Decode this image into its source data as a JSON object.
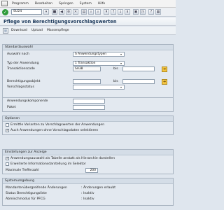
{
  "menu": {
    "items": [
      "Programm",
      "Bearbeiten",
      "Springen",
      "System",
      "Hilfe"
    ]
  },
  "toolbar": {
    "check_icon": "check-icon",
    "tcode_value": "SU24"
  },
  "window_title": "Pflege von Berechtigungsvorschlagswerten",
  "app_toolbar": {
    "buttons": [
      "Download",
      "Upload",
      "Massenpflege"
    ]
  },
  "standardauswahl": {
    "title": "Standardauswahl",
    "auswahl_nach_label": "Auswahl nach",
    "auswahl_nach_value": "S Anwendungstypen",
    "typ_label": "Typ der Anwendung",
    "typ_value": "1 Transaktion",
    "transaktionscode_label": "Transaktionscode",
    "transaktionscode_value": "SA38",
    "bis_label": "bis",
    "berechtigungsobjekt_label": "Berechtigungsobjekt",
    "berechtigungsobjekt_bis_label": "bis",
    "vorschlagsstatus_label": "Vorschlagsstatus",
    "anwendungskomponente_label": "Anwendungskomponente",
    "paket_label": "Paket"
  },
  "optionen": {
    "title": "Optionen",
    "items": [
      {
        "label": "Ermittle Varianten zu Vorschlagswerten der Anwendungen",
        "checked": false
      },
      {
        "label": "Auch Anwendungen ohne Vorschlagsdaten selektieren",
        "checked": true
      }
    ]
  },
  "einstellungen": {
    "title": "Einstellungen zur Anzeige",
    "items": [
      {
        "label": "Anwendungsauswahl als Tabelle anstatt als Hierarchie darstellen",
        "checked": true
      },
      {
        "label": "Erweiterte Informationsdarstellung im Selektor",
        "checked": false
      }
    ],
    "max_treffer_label": "Maximale Trefferzahl",
    "max_treffer_value": "200"
  },
  "systemumgebung": {
    "title": "Systemumgebung",
    "rows": [
      {
        "label": "Mandantenübergreifende Änderungen",
        "value": ": Änderungen erlaubt"
      },
      {
        "label": "Status Berechtigungsliste",
        "value": ": Inaktiv"
      },
      {
        "label": "Abmischmodus für PFCG",
        "value": ": Inaktiv"
      }
    ]
  },
  "colors": {
    "title": "#1d3a5c",
    "group_header": "#d4dde7",
    "check_green": "#2e9b3a",
    "select_yellow": "#f5c542"
  }
}
